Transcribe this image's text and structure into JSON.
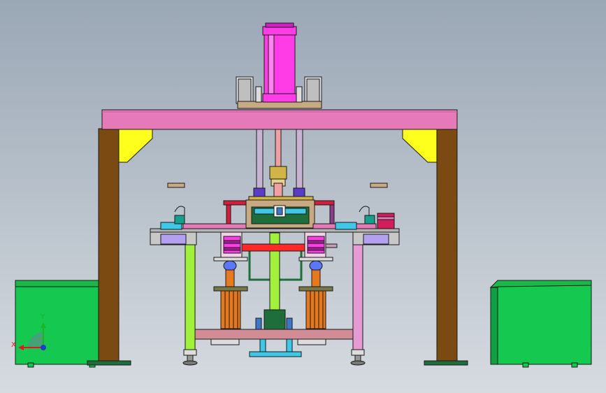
{
  "viewport": {
    "background_top": "#9aa7b5",
    "background_bottom": "#d6dbe0"
  },
  "triad": {
    "x_label": "X",
    "y_label": "Y",
    "x_color": "#e8141e",
    "y_color": "#1eb41e",
    "z_color": "#1e3cd2"
  },
  "colors": {
    "frame_pink": "#e67ab9",
    "post_brown": "#7a4a12",
    "gusset_yellow": "#ffff1e",
    "cabinet_green": "#14c850",
    "cylinder_magenta": "#ff3ce6",
    "leg_lime": "#a0f03c",
    "leg_pink": "#e69ad2",
    "bar_red": "#ff2828",
    "cyan": "#3cc8e6",
    "orange": "#e6781e",
    "olive": "#787846",
    "plate_tan": "#c8aa82",
    "dark_green": "#1e6e3c",
    "lavender": "#b4a0f0",
    "blue_disc": "#5a78ff",
    "gold": "#d2b446"
  }
}
